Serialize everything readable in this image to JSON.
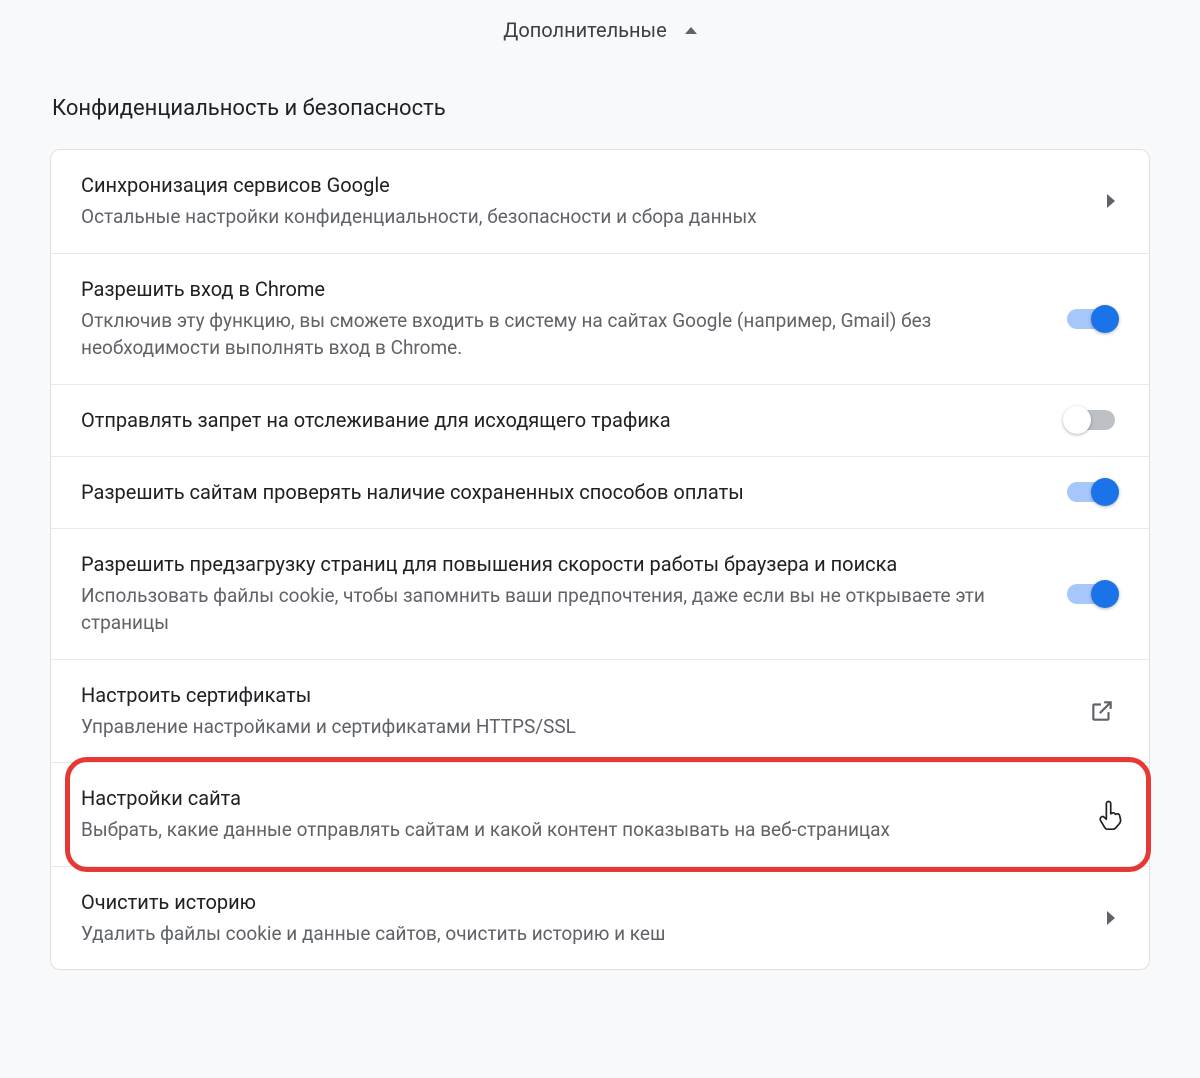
{
  "advanced_label": "Дополнительные",
  "section_title": "Конфиденциальность и безопасность",
  "rows": [
    {
      "title": "Синхронизация сервисов Google",
      "sub": "Остальные настройки конфиденциальности, безопасности и сбора данных",
      "control": "arrow"
    },
    {
      "title": "Разрешить вход в Chrome",
      "sub": "Отключив эту функцию, вы сможете входить в систему на сайтах Google (например, Gmail) без необходимости выполнять вход в Chrome.",
      "control": "toggle",
      "state": "on"
    },
    {
      "title": "Отправлять запрет на отслеживание для исходящего трафика",
      "sub": "",
      "control": "toggle",
      "state": "off"
    },
    {
      "title": "Разрешить сайтам проверять наличие сохраненных способов оплаты",
      "sub": "",
      "control": "toggle",
      "state": "on"
    },
    {
      "title": "Разрешить предзагрузку страниц для повышения скорости работы браузера и поиска",
      "sub": "Использовать файлы cookie, чтобы запомнить ваши предпочтения, даже если вы не открываете эти страницы",
      "control": "toggle",
      "state": "on"
    },
    {
      "title": "Настроить сертификаты",
      "sub": "Управление настройками и сертификатами HTTPS/SSL",
      "control": "external"
    },
    {
      "title": "Настройки сайта",
      "sub": "Выбрать, какие данные отправлять сайтам и какой контент показывать на веб-страницах",
      "control": "arrow",
      "highlighted": true,
      "cursor": true
    },
    {
      "title": "Очистить историю",
      "sub": "Удалить файлы cookie и данные сайтов, очистить историю и кеш",
      "control": "arrow"
    }
  ]
}
